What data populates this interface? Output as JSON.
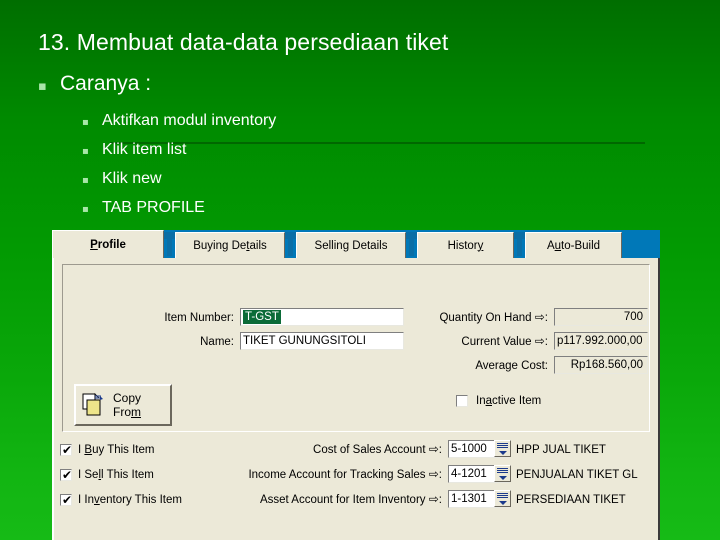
{
  "slide": {
    "title": "13. Membuat data-data persediaan tiket",
    "bullet_level1": "Caranya :",
    "bullets_level2": [
      "Aktifkan modul inventory",
      "Klik item list",
      "Klik new",
      "TAB PROFILE"
    ],
    "bullet_glyph": "▪",
    "background_top": "#006e00",
    "background_bottom": "#16bb16",
    "text_color": "#ffffff"
  },
  "dialog": {
    "tabs": [
      {
        "label": "Profile",
        "accel": "P",
        "active": true
      },
      {
        "label": "Buying Details",
        "accel": "t",
        "active": false
      },
      {
        "label": "Selling Details",
        "accel": "g",
        "active": false
      },
      {
        "label": "History",
        "accel": "y",
        "active": false
      },
      {
        "label": "Auto-Build",
        "accel": "u",
        "active": false
      }
    ],
    "tabstrip_color": "#0078b8",
    "panel_color": "#ece9d8",
    "left_fields": [
      {
        "label": "Item Number:",
        "value": "T-GST",
        "selected": true,
        "selection_color": "#0b6b38"
      },
      {
        "label": "Name:",
        "value": "TIKET GUNUNGSITOLI",
        "selected": false
      }
    ],
    "right_fields": [
      {
        "label": "Quantity On Hand",
        "arrow": "⇨",
        "separator": ":",
        "value": "700",
        "readonly": true
      },
      {
        "label": "Current Value",
        "arrow": "⇨",
        "separator": ":",
        "value": "p117.992.000,00",
        "readonly": true
      },
      {
        "label": "Average Cost:",
        "arrow": "",
        "separator": "",
        "value": "Rp168.560,00",
        "readonly": true
      }
    ],
    "copy_from": {
      "line1": "Copy",
      "line2": "From",
      "accel": "m",
      "icon": "copy-document-icon"
    },
    "inactive_item": {
      "label": "Inactive Item",
      "checked": false
    },
    "item_flags": [
      {
        "label": "I Buy This Item",
        "checked": true
      },
      {
        "label": "I Sell This Item",
        "checked": true
      },
      {
        "label": "I Inventory This Item",
        "checked": true
      }
    ],
    "accounts": [
      {
        "label": "Cost of Sales Account",
        "arrow": "⇨",
        "separator": ":",
        "code": "5-1000",
        "description": "HPP JUAL TIKET"
      },
      {
        "label": "Income Account for Tracking Sales",
        "arrow": "⇨",
        "separator": ":",
        "code": "4-1201",
        "description": "PENJUALAN TIKET GL"
      },
      {
        "label": "Asset Account for Item Inventory",
        "arrow": "⇨",
        "separator": ":",
        "code": "1-1301",
        "description": "PERSEDIAAN TIKET"
      }
    ],
    "lookup_icon": "account-lookup-icon",
    "checked_glyph": "✔"
  }
}
